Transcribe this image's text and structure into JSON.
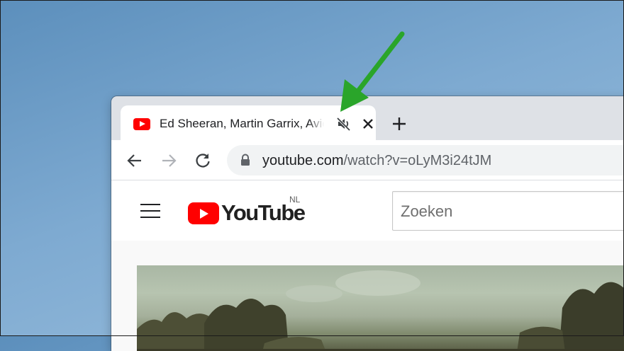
{
  "tab": {
    "title": "Ed Sheeran, Martin Garrix, Avicii",
    "favicon": "youtube-favicon",
    "mute_icon": "muted-speaker-icon",
    "close_icon": "close-icon"
  },
  "new_tab_icon": "plus-icon",
  "toolbar": {
    "back_icon": "arrow-left-icon",
    "forward_icon": "arrow-right-icon",
    "reload_icon": "reload-icon",
    "lock_icon": "lock-icon",
    "url_domain": "youtube.com",
    "url_path": "/watch?v=oLyM3i24tJM"
  },
  "youtube": {
    "menu_icon": "hamburger-icon",
    "logo_text": "YouTube",
    "region": "NL",
    "search_placeholder": "Zoeken"
  },
  "colors": {
    "youtube_red": "#ff0000",
    "annotation_arrow": "#2aa52a",
    "tabstrip": "#dee1e6"
  }
}
